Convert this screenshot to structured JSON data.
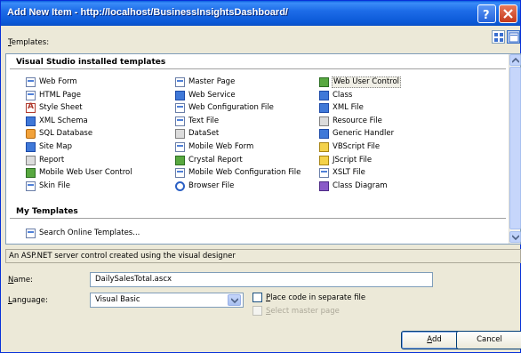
{
  "window": {
    "title": "Add New Item - http://localhost/BusinessInsightsDashboard/"
  },
  "templates_label": {
    "prefix": "T",
    "rest": "emplates:"
  },
  "groups": {
    "installed": "Visual Studio installed templates",
    "mine": "My Templates"
  },
  "columns": [
    [
      {
        "label": "Web Form",
        "icon": "web-form-icon",
        "style": "ic-page"
      },
      {
        "label": "HTML Page",
        "icon": "html-page-icon",
        "style": "ic-page"
      },
      {
        "label": "Style Sheet",
        "icon": "style-sheet-icon",
        "style": "ic-red"
      },
      {
        "label": "XML Schema",
        "icon": "xml-schema-icon",
        "style": "ic-blue"
      },
      {
        "label": "SQL Database",
        "icon": "sql-database-icon",
        "style": "ic-orange"
      },
      {
        "label": "Site Map",
        "icon": "site-map-icon",
        "style": "ic-blue"
      },
      {
        "label": "Report",
        "icon": "report-icon",
        "style": "ic-gray"
      },
      {
        "label": "Mobile Web User Control",
        "icon": "mobile-web-user-control-icon",
        "style": "ic-green"
      },
      {
        "label": "Skin File",
        "icon": "skin-file-icon",
        "style": "ic-page"
      }
    ],
    [
      {
        "label": "Master Page",
        "icon": "master-page-icon",
        "style": "ic-page"
      },
      {
        "label": "Web Service",
        "icon": "web-service-icon",
        "style": "ic-blue"
      },
      {
        "label": "Web Configuration File",
        "icon": "web-configuration-file-icon",
        "style": "ic-page"
      },
      {
        "label": "Text File",
        "icon": "text-file-icon",
        "style": "ic-page"
      },
      {
        "label": "DataSet",
        "icon": "dataset-icon",
        "style": "ic-gray"
      },
      {
        "label": "Mobile Web Form",
        "icon": "mobile-web-form-icon",
        "style": "ic-page"
      },
      {
        "label": "Crystal Report",
        "icon": "crystal-report-icon",
        "style": "ic-green"
      },
      {
        "label": "Mobile Web Configuration File",
        "icon": "mobile-web-configuration-file-icon",
        "style": "ic-page"
      },
      {
        "label": "Browser File",
        "icon": "browser-file-icon",
        "style": "ic-ring"
      }
    ],
    [
      {
        "label": "Web User Control",
        "icon": "web-user-control-icon",
        "style": "ic-green",
        "selected": true
      },
      {
        "label": "Class",
        "icon": "class-icon",
        "style": "ic-blue"
      },
      {
        "label": "XML File",
        "icon": "xml-file-icon",
        "style": "ic-blue"
      },
      {
        "label": "Resource File",
        "icon": "resource-file-icon",
        "style": "ic-gray"
      },
      {
        "label": "Generic Handler",
        "icon": "generic-handler-icon",
        "style": "ic-blue"
      },
      {
        "label": "VBScript File",
        "icon": "vbscript-file-icon",
        "style": "ic-yellow"
      },
      {
        "label": "JScript File",
        "icon": "jscript-file-icon",
        "style": "ic-yellow"
      },
      {
        "label": "XSLT File",
        "icon": "xslt-file-icon",
        "style": "ic-page"
      },
      {
        "label": "Class Diagram",
        "icon": "class-diagram-icon",
        "style": "ic-purple"
      }
    ]
  ],
  "search_online": "Search Online Templates...",
  "description": "An ASP.NET server control created using the visual designer",
  "form": {
    "name_prefix": "N",
    "name_rest": "ame:",
    "name_value": "DailySalesTotal.ascx",
    "language_prefix": "L",
    "language_rest": "anguage:",
    "language_value": "Visual Basic",
    "place_code_prefix": "P",
    "place_code_rest": "lace code in separate file",
    "select_master_prefix": "S",
    "select_master_rest": "elect master page"
  },
  "buttons": {
    "add_prefix": "A",
    "add_rest": "dd",
    "cancel": "Cancel"
  }
}
